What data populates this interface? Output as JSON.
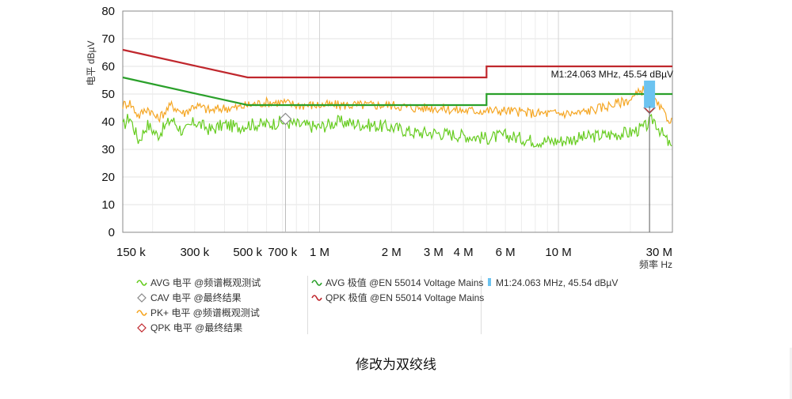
{
  "chart_data": {
    "type": "line",
    "title": "",
    "ylabel": "电平 dBµV",
    "xlabel": "频率 Hz",
    "x_scale": "log",
    "xlim_hz": [
      150000,
      30000000
    ],
    "ylim": [
      0,
      80
    ],
    "grid": true,
    "y_ticks": [
      0,
      10,
      20,
      30,
      40,
      50,
      60,
      70,
      80
    ],
    "x_ticks": [
      {
        "value": 150000,
        "label": "150 k"
      },
      {
        "value": 300000,
        "label": "300 k"
      },
      {
        "value": 500000,
        "label": "500 k"
      },
      {
        "value": 700000,
        "label": "700 k"
      },
      {
        "value": 1000000,
        "label": "1 M"
      },
      {
        "value": 2000000,
        "label": "2 M"
      },
      {
        "value": 3000000,
        "label": "3 M"
      },
      {
        "value": 4000000,
        "label": "4 M"
      },
      {
        "value": 6000000,
        "label": "6 M"
      },
      {
        "value": 10000000,
        "label": "10 M"
      },
      {
        "value": 30000000,
        "label": "30 M"
      }
    ],
    "series": [
      {
        "name": "AVG 电平 @频谱概观测试",
        "color": "#66cc1f",
        "points": [
          [
            150000,
            38
          ],
          [
            160000,
            42
          ],
          [
            175000,
            33
          ],
          [
            190000,
            39
          ],
          [
            210000,
            35
          ],
          [
            240000,
            41
          ],
          [
            270000,
            36
          ],
          [
            300000,
            40
          ],
          [
            350000,
            37
          ],
          [
            400000,
            39
          ],
          [
            450000,
            38
          ],
          [
            500000,
            39
          ],
          [
            600000,
            39
          ],
          [
            700000,
            40
          ],
          [
            800000,
            39
          ],
          [
            1000000,
            38
          ],
          [
            1200000,
            40
          ],
          [
            1500000,
            39
          ],
          [
            2000000,
            38
          ],
          [
            2500000,
            36
          ],
          [
            3000000,
            36
          ],
          [
            4000000,
            35
          ],
          [
            5000000,
            34
          ],
          [
            6000000,
            35
          ],
          [
            8000000,
            33
          ],
          [
            10000000,
            33
          ],
          [
            12000000,
            34
          ],
          [
            15000000,
            35
          ],
          [
            20000000,
            36
          ],
          [
            23000000,
            38
          ],
          [
            25000000,
            41
          ],
          [
            27000000,
            36
          ],
          [
            29000000,
            32
          ],
          [
            30000000,
            30
          ]
        ]
      },
      {
        "name": "PK+ 电平 @频谱概观测试",
        "color": "#f5a623",
        "points": [
          [
            150000,
            46
          ],
          [
            160000,
            47
          ],
          [
            175000,
            42
          ],
          [
            190000,
            45
          ],
          [
            210000,
            41
          ],
          [
            240000,
            46
          ],
          [
            270000,
            43
          ],
          [
            300000,
            46
          ],
          [
            350000,
            44
          ],
          [
            400000,
            45
          ],
          [
            450000,
            45
          ],
          [
            500000,
            46
          ],
          [
            600000,
            47
          ],
          [
            700000,
            47
          ],
          [
            800000,
            46
          ],
          [
            1000000,
            46
          ],
          [
            1200000,
            46
          ],
          [
            1500000,
            46
          ],
          [
            2000000,
            46
          ],
          [
            2500000,
            45
          ],
          [
            3000000,
            45
          ],
          [
            4000000,
            44
          ],
          [
            5000000,
            44
          ],
          [
            6000000,
            44
          ],
          [
            8000000,
            43
          ],
          [
            10000000,
            43
          ],
          [
            12000000,
            43
          ],
          [
            15000000,
            45
          ],
          [
            20000000,
            48
          ],
          [
            23000000,
            52
          ],
          [
            25000000,
            48
          ],
          [
            27000000,
            44
          ],
          [
            29000000,
            41
          ],
          [
            30000000,
            40
          ]
        ]
      },
      {
        "name": "AVG 极值 @EN 55014 Voltage Mains",
        "color": "#2aa02a",
        "points": [
          [
            150000,
            56
          ],
          [
            500000,
            46
          ],
          [
            5000000,
            46
          ],
          [
            5000000,
            50
          ],
          [
            30000000,
            50
          ]
        ]
      },
      {
        "name": "QPK 极值 @EN 55014 Voltage Mains",
        "color": "#c0272d",
        "points": [
          [
            150000,
            66
          ],
          [
            500000,
            56
          ],
          [
            5000000,
            56
          ],
          [
            5000000,
            60
          ],
          [
            30000000,
            60
          ]
        ]
      }
    ],
    "final_results": {
      "cav": [
        {
          "x": 720000,
          "y": 41
        },
        {
          "x": 24063000,
          "y": 45
        }
      ],
      "qpk": [
        {
          "x": 24063000,
          "y": 45
        }
      ]
    },
    "marker": {
      "label": "M1:24.063 MHz, 45.54 dBµV",
      "x": 24063000,
      "y": 45.54,
      "color": "#6cc3f0"
    },
    "legend": {
      "col1": [
        "AVG 电平 @频谱概观测试",
        "CAV 电平 @最终结果",
        "PK+ 电平 @频谱概观测试",
        "QPK 电平 @最终结果"
      ],
      "col2": [
        "AVG 极值 @EN 55014 Voltage Mains",
        "QPK 极值 @EN 55014 Voltage Mains"
      ],
      "col3": [
        "M1:24.063 MHz, 45.54 dBµV"
      ]
    }
  },
  "caption": "修改为双绞线"
}
